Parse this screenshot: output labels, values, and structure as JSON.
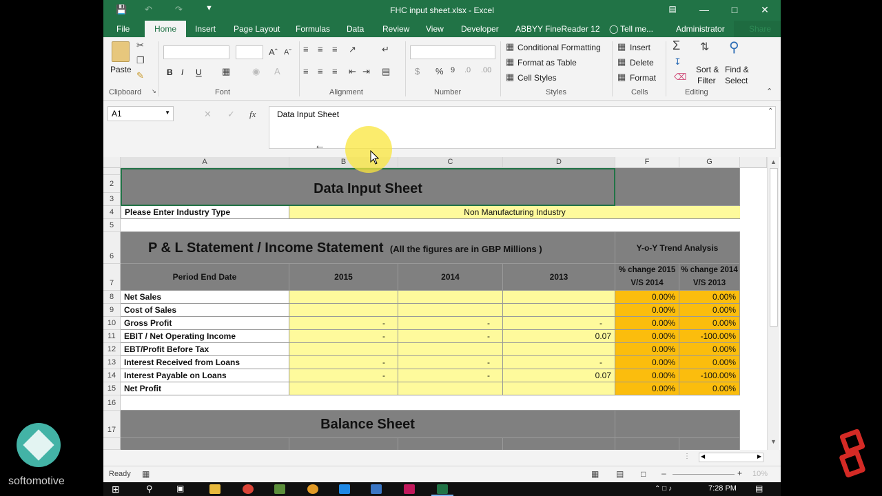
{
  "window": {
    "title": "FHC input sheet.xlsx - Excel"
  },
  "tabs": [
    "File",
    "Home",
    "Insert",
    "Page Layout",
    "Formulas",
    "Data",
    "Review",
    "View",
    "Developer",
    "ABBYY FineReader 12",
    "Tell me...",
    "Administrator",
    "Share"
  ],
  "ribbon": {
    "paste": "Paste",
    "clipboard": "Clipboard",
    "font": "Font",
    "alignment": "Alignment",
    "number": "Number",
    "styles": "Styles",
    "cells": "Cells",
    "editing": "Editing",
    "conditional_formatting": "Conditional Formatting",
    "format_as_table": "Format as Table",
    "cell_styles": "Cell Styles",
    "insert": "Insert",
    "delete": "Delete",
    "format": "Format",
    "sort_filter_1": "Sort &",
    "sort_filter_2": "Filter",
    "find_select_1": "Find &",
    "find_select_2": "Select",
    "bold": "B",
    "italic": "I",
    "underline": "U"
  },
  "formula_bar": {
    "name_box": "A1",
    "fx": "fx",
    "content": "Data Input Sheet"
  },
  "columns": [
    "A",
    "B",
    "C",
    "D",
    "F",
    "G"
  ],
  "rows": [
    "2",
    "3",
    "4",
    "5",
    "6",
    "7",
    "8",
    "9",
    "10",
    "11",
    "12",
    "13",
    "14",
    "15",
    "16",
    "17"
  ],
  "sheet": {
    "title": "Data Input Sheet",
    "industry_label": "Please Enter Industry Type",
    "industry_value": "Non Manufacturing Industry",
    "pl_title": "P & L Statement / Income Statement",
    "pl_note": "(All the figures are in GBP Millions )",
    "yoy": "Y-o-Y Trend Analysis",
    "period_label": "Period End Date",
    "years": [
      "2015",
      "2014",
      "2013"
    ],
    "pct1": "% change 2015 V/S 2014",
    "pct2": "% change 2014 V/S 2013",
    "lines": [
      {
        "label": "Net Sales",
        "b": "",
        "c": "",
        "d": "",
        "f": "0.00%",
        "g": "0.00%"
      },
      {
        "label": "Cost of Sales",
        "b": "",
        "c": "",
        "d": "",
        "f": "0.00%",
        "g": "0.00%"
      },
      {
        "label": "Gross Profit",
        "b": "-",
        "c": "-",
        "d": "-",
        "f": "0.00%",
        "g": "0.00%"
      },
      {
        "label": "EBIT / Net Operating Income",
        "b": "-",
        "c": "-",
        "d": "0.07",
        "f": "0.00%",
        "g": "-100.00%"
      },
      {
        "label": "EBT/Profit Before Tax",
        "b": "",
        "c": "",
        "d": "",
        "f": "0.00%",
        "g": "0.00%"
      },
      {
        "label": "Interest Received from Loans",
        "b": "-",
        "c": "-",
        "d": "-",
        "f": "0.00%",
        "g": "0.00%"
      },
      {
        "label": "Interest Payable on Loans",
        "b": "-",
        "c": "-",
        "d": "0.07",
        "f": "0.00%",
        "g": "-100.00%"
      },
      {
        "label": "Net Profit",
        "b": "",
        "c": "",
        "d": "",
        "f": "0.00%",
        "g": "0.00%"
      }
    ],
    "balance_title": "Balance Sheet"
  },
  "status": {
    "ready": "Ready",
    "zoom": "10%"
  },
  "taskbar": {
    "time": "7:28 PM"
  },
  "overlay": {
    "brand": "softomotive"
  },
  "colors": {
    "excel_green": "#217346",
    "header_gray": "#808080",
    "input_yellow": "#fefa9c",
    "trend_orange": "#fbbd0d"
  }
}
